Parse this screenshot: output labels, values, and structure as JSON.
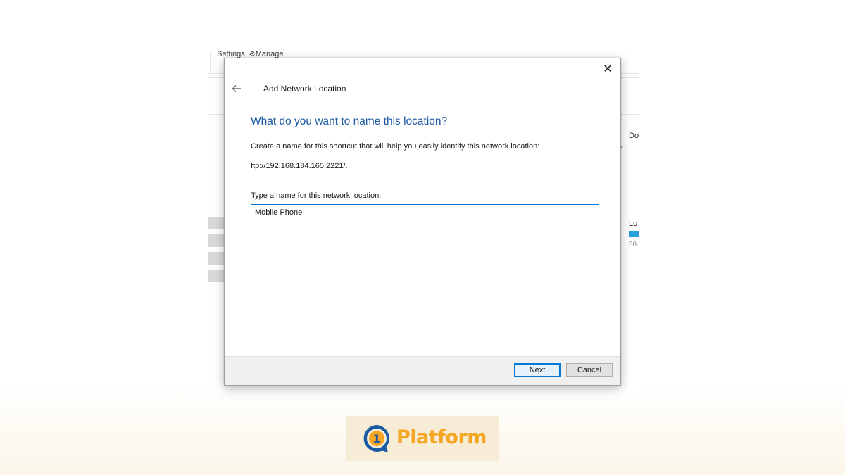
{
  "background_window": {
    "ribbon_settings": "Settings",
    "ribbon_manage": "Manage",
    "right_label_top": "Do",
    "right_label_mid": "Lo",
    "right_label_bottom": "56."
  },
  "dialog": {
    "title": "Add Network Location",
    "heading": "What do you want to name this location?",
    "description": "Create a name for this shortcut that will help you easily identify this network location:",
    "url": "ftp://192.168.184.165:2221/.",
    "field_label": "Type a name for this network location:",
    "field_value": "Mobile Phone",
    "close_symbol": "✕",
    "next_label": "Next",
    "cancel_label": "Cancel"
  },
  "brand": {
    "logo_text": "Platform",
    "logo_mark_text": "1",
    "colors": {
      "orange": "#f5a623",
      "blue": "#1c5aa3",
      "heading_blue": "#1c5aa3"
    }
  },
  "icons": [
    "back-arrow-icon",
    "close-icon",
    "manage-icon",
    "logo-icon"
  ]
}
